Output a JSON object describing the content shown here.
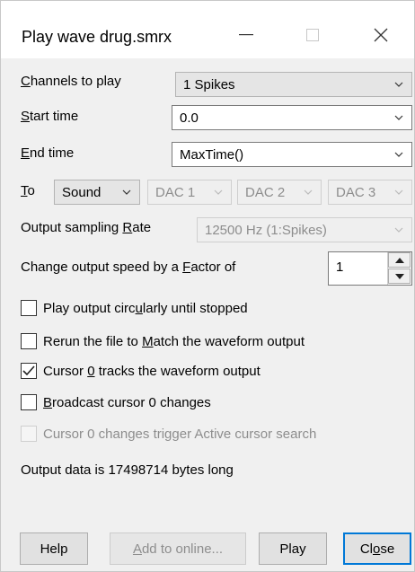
{
  "window": {
    "title": "Play wave drug.smrx"
  },
  "channels": {
    "label_pre": "",
    "label_key": "C",
    "label_post": "hannels to play",
    "value": "1 Spikes"
  },
  "start_time": {
    "label_pre": "",
    "label_key": "S",
    "label_post": "tart time",
    "value": "0.0"
  },
  "end_time": {
    "label_pre": "",
    "label_key": "E",
    "label_post": "nd time",
    "value": "MaxTime()"
  },
  "to": {
    "label_pre": "",
    "label_key": "T",
    "label_post": "o",
    "output": "Sound",
    "dac1": "DAC 1",
    "dac2": "DAC 2",
    "dac3": "DAC 3"
  },
  "sampling_rate": {
    "label_pre": "Output sampling ",
    "label_key": "R",
    "label_post": "ate",
    "value": "12500 Hz (1:Spikes)"
  },
  "speed_factor": {
    "label_pre": "Change output speed by a ",
    "label_key": "F",
    "label_post": "actor of",
    "value": "1"
  },
  "options": {
    "circular": {
      "pre": "Play output circ",
      "key": "u",
      "post": "larly until stopped",
      "checked": false
    },
    "rerun": {
      "pre": "Rerun the file to ",
      "key": "M",
      "post": "atch the waveform output",
      "checked": false
    },
    "cursor_tracks": {
      "pre": "Cursor ",
      "key": "0",
      "post": " tracks the waveform output",
      "checked": true
    },
    "broadcast": {
      "pre": "",
      "key": "B",
      "post": "roadcast cursor 0 changes",
      "checked": false
    },
    "trigger_search": {
      "label": "Cursor 0 changes trigger Active cursor search",
      "checked": false,
      "enabled": false
    }
  },
  "status_text": "Output data is 17498714 bytes long",
  "buttons": {
    "help": "Help",
    "add_online": {
      "key": "A",
      "post": "dd to online..."
    },
    "play": "Play",
    "close": {
      "pre": "Cl",
      "key": "o",
      "post": "se"
    }
  }
}
